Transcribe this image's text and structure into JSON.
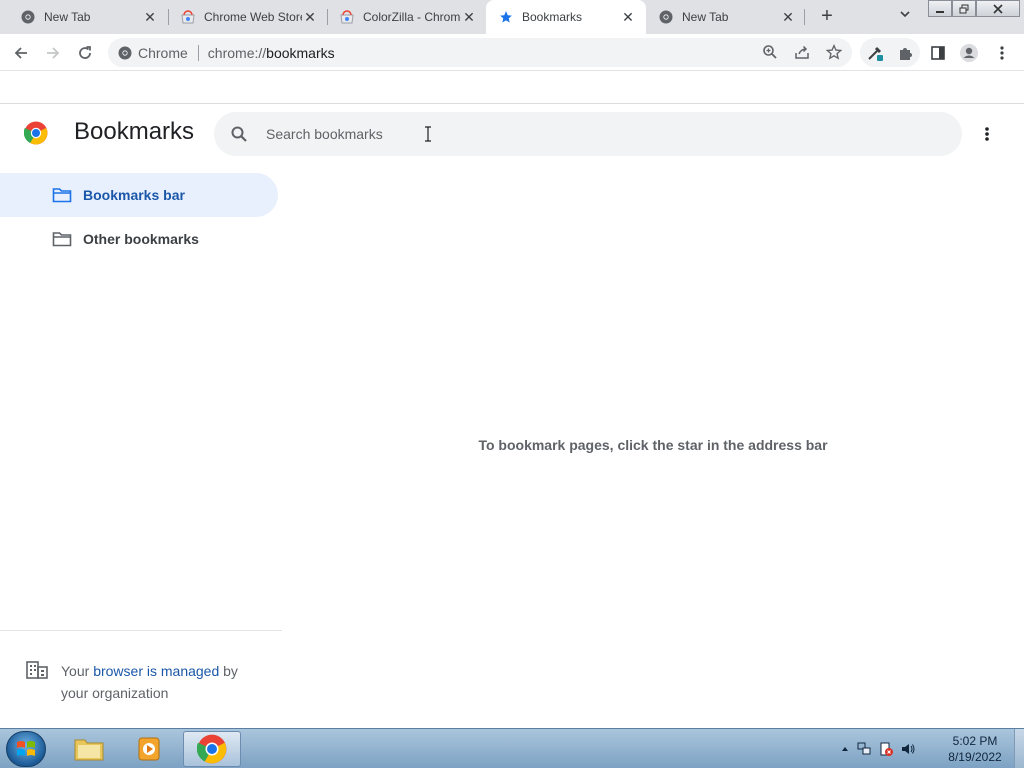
{
  "browser": {
    "tabs": [
      {
        "title": "New Tab",
        "icon": "chrome-icon",
        "active": false
      },
      {
        "title": "Chrome Web Store",
        "icon": "webstore-icon",
        "active": false
      },
      {
        "title": "ColorZilla - Chrome",
        "icon": "webstore-icon",
        "active": false
      },
      {
        "title": "Bookmarks",
        "icon": "star-icon",
        "active": true
      },
      {
        "title": "New Tab",
        "icon": "chrome-icon",
        "active": false
      }
    ],
    "omnibox": {
      "chip": "Chrome",
      "url_scheme": "chrome://",
      "url_host": "bookmarks"
    }
  },
  "page": {
    "title": "Bookmarks",
    "search_placeholder": "Search bookmarks",
    "sidebar": [
      {
        "label": "Bookmarks bar",
        "selected": true
      },
      {
        "label": "Other bookmarks",
        "selected": false
      }
    ],
    "empty_message": "To bookmark pages, click the star in the address bar",
    "managed": {
      "prefix": "Your ",
      "link": "browser is managed",
      "suffix": " by your organization"
    }
  },
  "taskbar": {
    "time": "5:02 PM",
    "date": "8/19/2022"
  },
  "colors": {
    "accent": "#1a57a8",
    "selected_bg": "#e8f0fe"
  }
}
